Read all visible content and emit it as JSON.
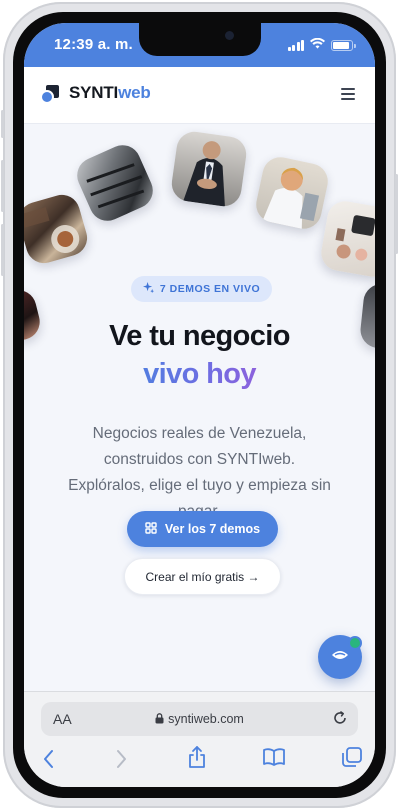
{
  "status_bar": {
    "time": "12:39 a. m."
  },
  "header": {
    "brand_prefix": "SYNTI",
    "brand_suffix": "web"
  },
  "hero": {
    "badge": "7 DEMOS EN VIVO",
    "title_line1": "Ve tu negocio",
    "title_line2": "vivo hoy",
    "subtitle": "Negocios reales de Venezuela, construidos con SYNTIweb. Explóralos, elige el tuyo y empieza sin pagar.",
    "primary_button": "Ver los 7 demos",
    "secondary_button": "Crear el mío gratis →"
  },
  "browser": {
    "text_size_label": "AA",
    "url": "syntiweb.com"
  },
  "colors": {
    "accent": "#4d82de",
    "title": "#12151c",
    "muted": "#656c79",
    "badge_bg": "#dde7fb"
  },
  "icons": [
    "sparkles-icon",
    "grid-icon",
    "chat-icon",
    "lock-icon",
    "reload-icon",
    "back-icon",
    "forward-icon",
    "share-icon",
    "bookmarks-icon",
    "tabs-icon",
    "menu-icon"
  ]
}
